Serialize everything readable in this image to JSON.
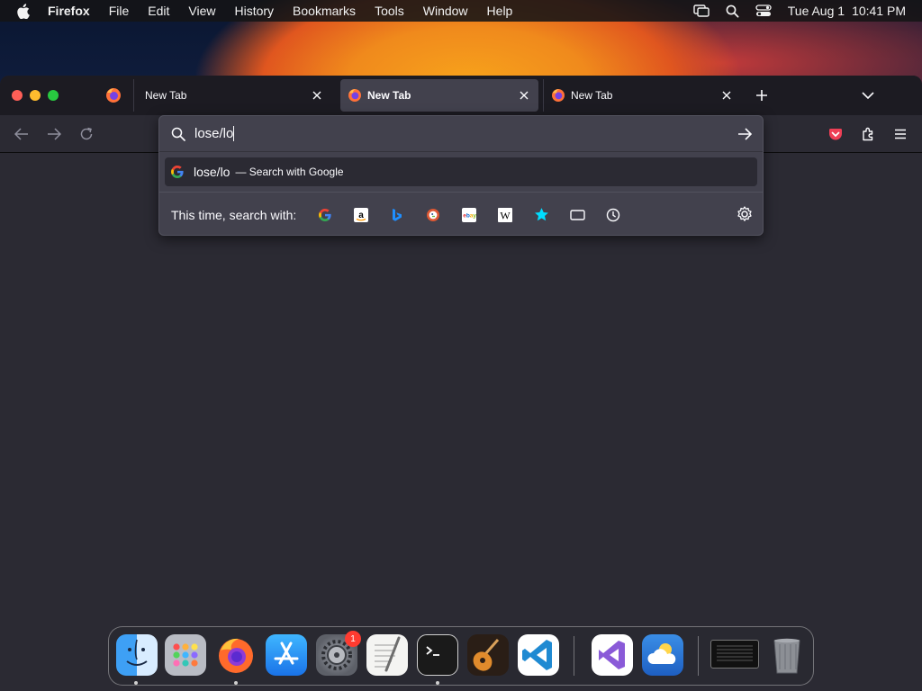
{
  "menubar": {
    "app_name": "Firefox",
    "menus": [
      "File",
      "Edit",
      "View",
      "History",
      "Bookmarks",
      "Tools",
      "Window",
      "Help"
    ],
    "date": "Tue Aug 1",
    "time": "10:41 PM"
  },
  "tabs": [
    {
      "label": "New Tab",
      "active": false,
      "favicon": "none"
    },
    {
      "label": "New Tab",
      "active": true,
      "favicon": "firefox-icon"
    },
    {
      "label": "New Tab",
      "active": false,
      "favicon": "firefox-icon"
    }
  ],
  "urlbar": {
    "value": "lose/lo",
    "suggestion": {
      "query": "lose/lo",
      "action": "— Search with Google"
    },
    "oneoff_label": "This time, search with:",
    "engines": [
      "google",
      "amazon",
      "bing",
      "duckduckgo",
      "ebay",
      "wikipedia",
      "bookmarks",
      "tabs",
      "history"
    ]
  },
  "dock": {
    "apps": [
      "Finder",
      "Launchpad",
      "Firefox",
      "App Store",
      "System Settings",
      "TextEdit",
      "Terminal",
      "GarageBand",
      "Visual Studio Code",
      "Visual Studio",
      "Weather",
      "Screenshot",
      "Trash"
    ],
    "settings_badge": "1"
  },
  "colors": {
    "toolbar": "#2b2a33",
    "tabbar": "#1c1b22",
    "popup": "#42414d",
    "accent_pocket": "#ef3f56"
  }
}
